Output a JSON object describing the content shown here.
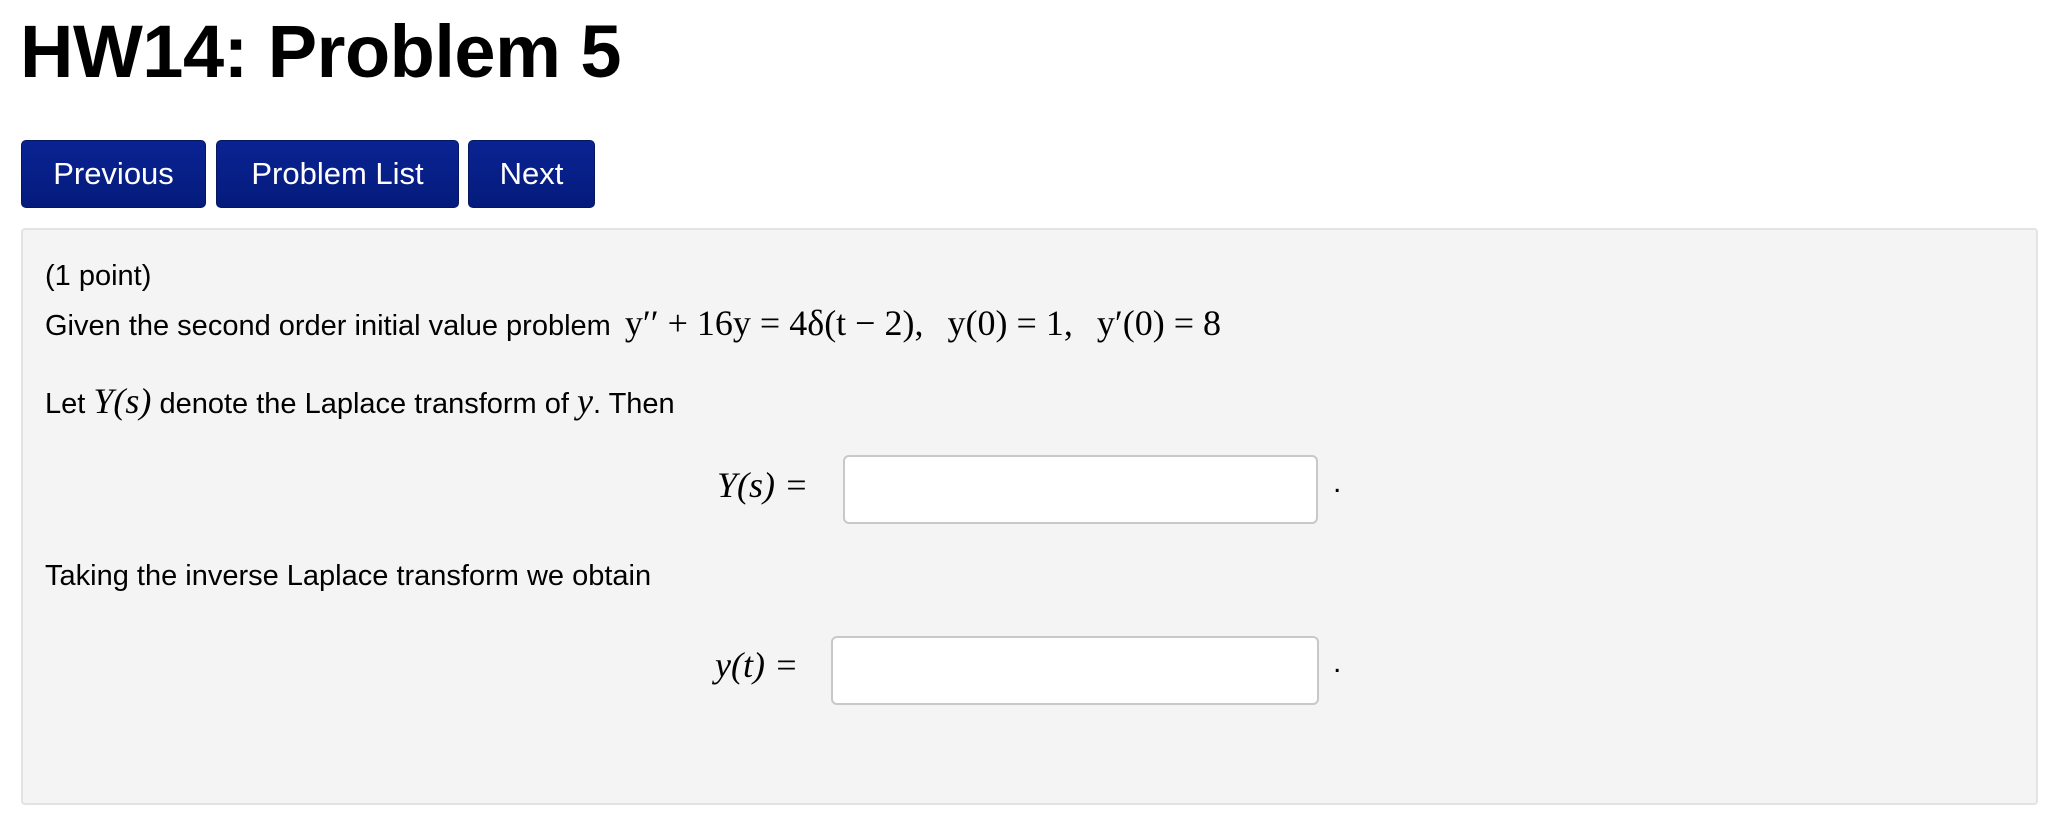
{
  "page": {
    "title": "HW14: Problem 5"
  },
  "nav": {
    "previous": "Previous",
    "problem_list": "Problem List",
    "next": "Next"
  },
  "problem": {
    "points": "(1 point)",
    "intro": "Given the second order initial value problem",
    "equation": {
      "ode": "y′′ + 16y = 4δ(t − 2),",
      "ic1": "y(0) = 1,",
      "ic2": "y′(0) = 8"
    },
    "laplace_pre": "Let",
    "laplace_symbol": "Y(s)",
    "laplace_mid": "denote the Laplace transform of",
    "laplace_var": "y",
    "laplace_post": ". Then",
    "answer1_label": "Y(s) =",
    "answer1_value": "",
    "answer1_end": ".",
    "inverse_text": "Taking the inverse Laplace transform we obtain",
    "answer2_label": "y(t) =",
    "answer2_value": "",
    "answer2_end": "."
  }
}
